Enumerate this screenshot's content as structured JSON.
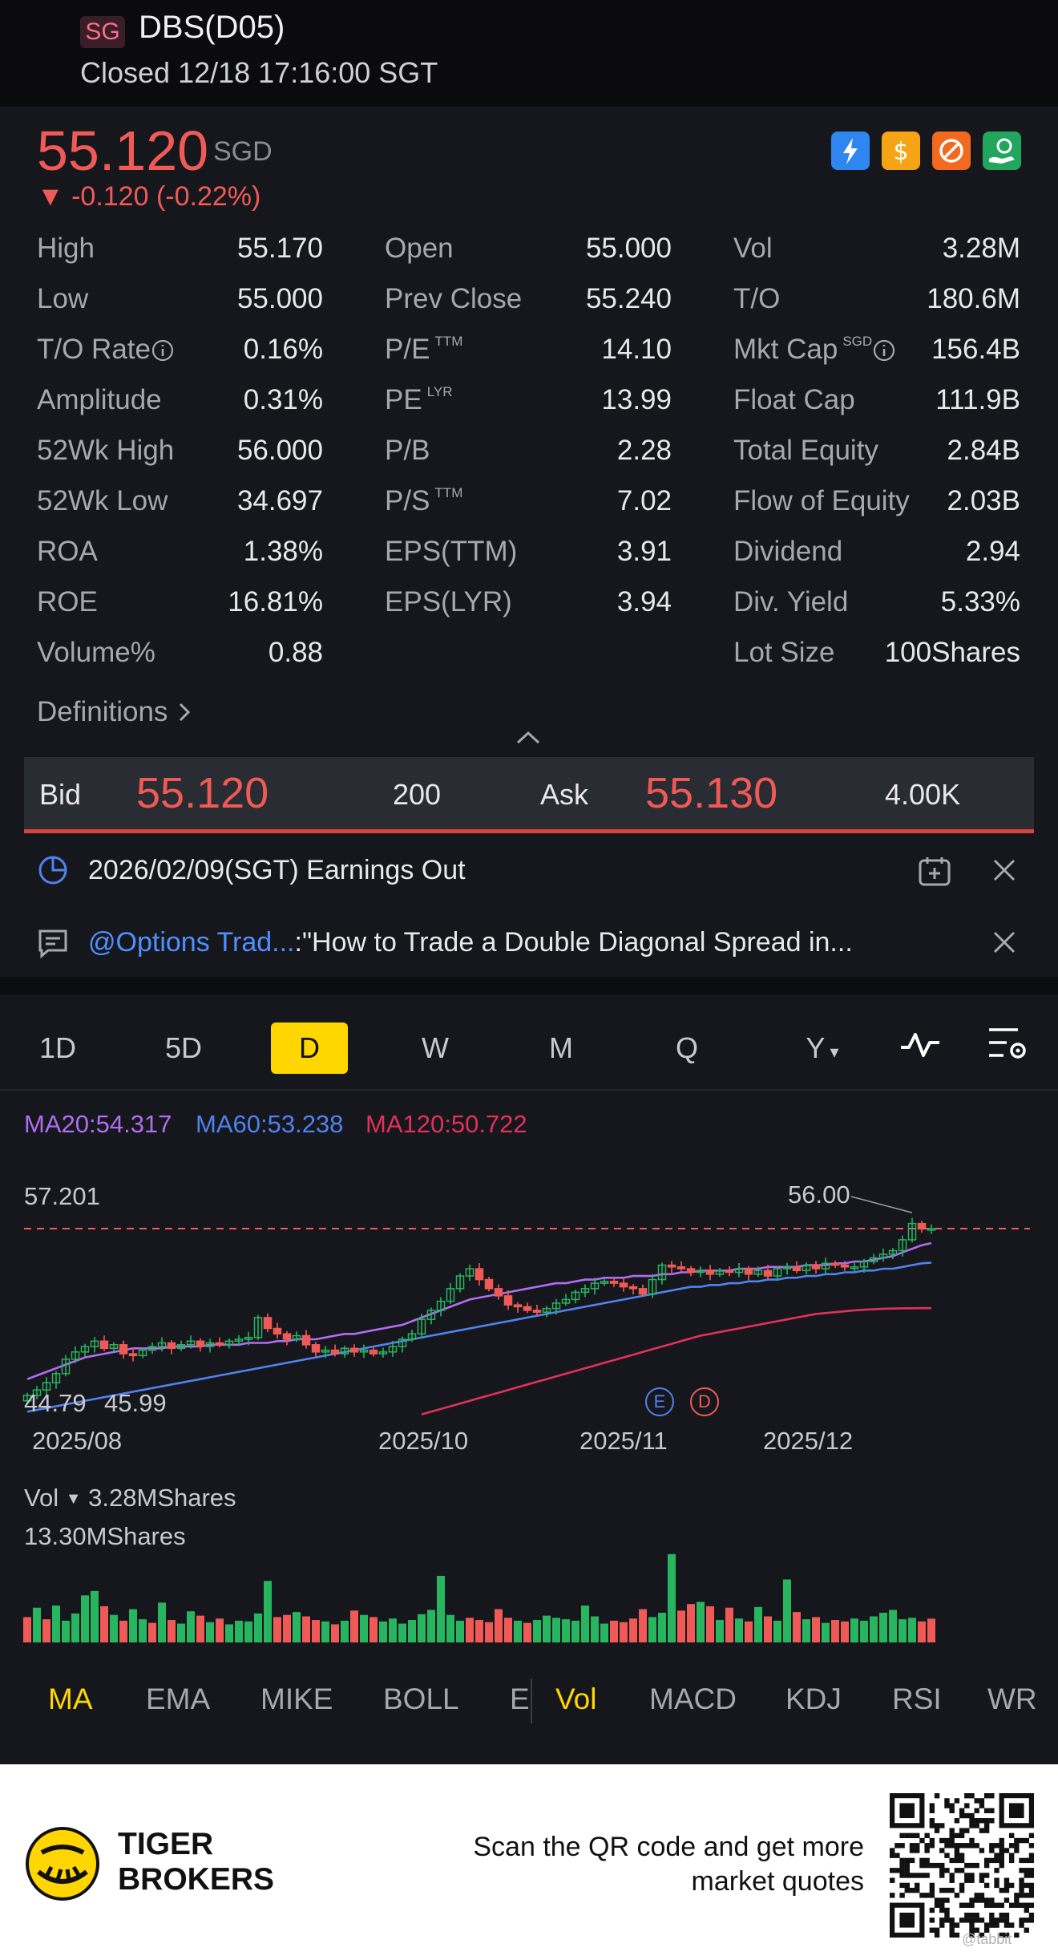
{
  "header": {
    "exchange": "SG",
    "title": "DBS(D05)",
    "status": "Closed 12/18 17:16:00 SGT"
  },
  "quote": {
    "price": "55.120",
    "currency": "SGD",
    "change": "▼ -0.120 (-0.22%)",
    "icons": [
      "lightning-icon",
      "dollar-icon",
      "no-short-icon",
      "money-hand-icon"
    ],
    "stats": [
      [
        {
          "label": "High",
          "value": "55.170"
        },
        {
          "label": "Open",
          "value": "55.000"
        },
        {
          "label": "Vol",
          "value": "3.28M"
        }
      ],
      [
        {
          "label": "Low",
          "value": "55.000"
        },
        {
          "label": "Prev Close",
          "value": "55.240"
        },
        {
          "label": "T/O",
          "value": "180.6M"
        }
      ],
      [
        {
          "label": "T/O Rate",
          "value": "0.16%"
        },
        {
          "label": "P/E",
          "sup": "TTM",
          "value": "14.10"
        },
        {
          "label": "Mkt Cap",
          "sup": "SGD",
          "value": "156.4B"
        }
      ],
      [
        {
          "label": "Amplitude",
          "value": "0.31%"
        },
        {
          "label": "PE",
          "sup": "LYR",
          "value": "13.99"
        },
        {
          "label": "Float Cap",
          "value": "111.9B"
        }
      ],
      [
        {
          "label": "52Wk High",
          "value": "56.000"
        },
        {
          "label": "P/B",
          "value": "2.28"
        },
        {
          "label": "Total Equity",
          "value": "2.84B"
        }
      ],
      [
        {
          "label": "52Wk Low",
          "value": "34.697"
        },
        {
          "label": "P/S",
          "sup": "TTM",
          "value": "7.02"
        },
        {
          "label": "Flow of Equity",
          "value": "2.03B"
        }
      ],
      [
        {
          "label": "ROA",
          "value": "1.38%"
        },
        {
          "label": "EPS(TTM)",
          "value": "3.91"
        },
        {
          "label": "Dividend",
          "value": "2.94"
        }
      ],
      [
        {
          "label": "ROE",
          "value": "16.81%"
        },
        {
          "label": "EPS(LYR)",
          "value": "3.94"
        },
        {
          "label": "Div. Yield",
          "value": "5.33%"
        }
      ],
      [
        {
          "label": "Volume%",
          "value": "0.88"
        },
        {
          "label": "",
          "value": ""
        },
        {
          "label": "Lot Size",
          "value": "100Shares"
        }
      ]
    ],
    "definitions": "Definitions"
  },
  "bidask": {
    "bid_label": "Bid",
    "bid_price": "55.120",
    "bid_size": "200",
    "ask_label": "Ask",
    "ask_price": "55.130",
    "ask_size": "4.00K"
  },
  "notices": {
    "earnings": "2026/02/09(SGT) Earnings Out",
    "post_handle": "@Options Trad...",
    "post_text": ":\"How to Trade a Double Diagonal Spread in..."
  },
  "periods": [
    "1D",
    "5D",
    "D",
    "W",
    "M",
    "Q",
    "Y"
  ],
  "active_period": "D",
  "ma_legend": {
    "ma20": "MA20:54.317",
    "ma60": "MA60:53.238",
    "ma120": "MA120:50.722"
  },
  "colors": {
    "up": "#27b560",
    "down": "#f05a56",
    "ma20": "#b06cf2",
    "ma60": "#4f82ee",
    "ma120": "#e2305b",
    "accent": "#ffd600"
  },
  "chart_data": {
    "type": "candlestick",
    "price_high_label": "57.201",
    "price_low_label": "44.79",
    "marked_high": "56.00",
    "marked_low": "45.99",
    "event_markers": [
      "E",
      "D"
    ],
    "x_ticks": [
      "2025/08",
      "2025/10",
      "2025/11",
      "2025/12"
    ],
    "ylim": [
      44.79,
      57.201
    ],
    "closes": [
      45.9,
      46.2,
      46.6,
      47.1,
      47.9,
      48.3,
      48.6,
      48.9,
      48.5,
      48.7,
      48.2,
      48.1,
      48.4,
      48.6,
      48.8,
      48.5,
      48.7,
      48.9,
      48.6,
      48.8,
      48.7,
      48.9,
      49.0,
      49.1,
      50.2,
      49.6,
      49.3,
      49.0,
      49.2,
      48.7,
      48.3,
      48.4,
      48.2,
      48.5,
      48.3,
      48.4,
      48.2,
      48.3,
      48.6,
      49.0,
      49.3,
      50.1,
      50.6,
      51.1,
      51.8,
      52.5,
      52.9,
      52.3,
      51.8,
      51.4,
      50.9,
      50.8,
      50.6,
      50.5,
      50.7,
      51.0,
      51.2,
      51.6,
      51.8,
      52.1,
      52.2,
      52.1,
      51.9,
      51.8,
      51.5,
      52.3,
      53.1,
      53.0,
      52.9,
      52.7,
      52.8,
      52.6,
      52.8,
      52.7,
      52.9,
      52.6,
      52.8,
      52.5,
      52.9,
      53.0,
      52.8,
      53.1,
      52.9,
      53.2,
      53.1,
      53.0,
      53.0,
      53.3,
      53.5,
      53.7,
      53.9,
      54.5,
      55.4,
      55.1,
      55.12
    ],
    "ma20": [
      46.8,
      47.0,
      47.2,
      47.4,
      47.6,
      47.8,
      48.0,
      48.1,
      48.2,
      48.3,
      48.4,
      48.5,
      48.5,
      48.5,
      48.5,
      48.6,
      48.6,
      48.6,
      48.6,
      48.7,
      48.7,
      48.7,
      48.7,
      48.8,
      48.8,
      48.8,
      48.9,
      48.9,
      49.0,
      49.0,
      49.0,
      49.1,
      49.2,
      49.3,
      49.3,
      49.4,
      49.5,
      49.6,
      49.7,
      49.8,
      50.0,
      50.2,
      50.4,
      50.6,
      50.8,
      51.0,
      51.2,
      51.3,
      51.4,
      51.5,
      51.6,
      51.7,
      51.8,
      51.9,
      52.0,
      52.1,
      52.1,
      52.2,
      52.3,
      52.3,
      52.4,
      52.4,
      52.4,
      52.5,
      52.5,
      52.5,
      52.6,
      52.6,
      52.7,
      52.7,
      52.8,
      52.8,
      52.8,
      52.8,
      52.9,
      52.9,
      52.9,
      53.0,
      53.0,
      53.0,
      53.0,
      53.1,
      53.1,
      53.1,
      53.2,
      53.2,
      53.3,
      53.3,
      53.4,
      53.5,
      53.6,
      53.8,
      54.0,
      54.2,
      54.317
    ],
    "ma60": [
      45.0,
      45.1,
      45.2,
      45.3,
      45.4,
      45.5,
      45.6,
      45.7,
      45.8,
      45.9,
      46.0,
      46.1,
      46.2,
      46.3,
      46.4,
      46.5,
      46.6,
      46.7,
      46.8,
      46.9,
      47.0,
      47.1,
      47.2,
      47.3,
      47.4,
      47.5,
      47.6,
      47.7,
      47.8,
      47.9,
      48.0,
      48.1,
      48.2,
      48.3,
      48.4,
      48.5,
      48.6,
      48.7,
      48.8,
      48.9,
      49.0,
      49.1,
      49.2,
      49.3,
      49.4,
      49.5,
      49.6,
      49.7,
      49.8,
      49.9,
      50.0,
      50.1,
      50.2,
      50.3,
      50.4,
      50.5,
      50.6,
      50.7,
      50.8,
      50.9,
      51.0,
      51.1,
      51.2,
      51.3,
      51.4,
      51.5,
      51.6,
      51.7,
      51.8,
      51.9,
      51.9,
      52.0,
      52.0,
      52.1,
      52.1,
      52.2,
      52.2,
      52.3,
      52.3,
      52.4,
      52.4,
      52.5,
      52.5,
      52.6,
      52.6,
      52.7,
      52.7,
      52.8,
      52.8,
      52.9,
      52.9,
      53.0,
      53.1,
      53.2,
      53.238
    ],
    "ma120": [
      null,
      null,
      null,
      null,
      null,
      null,
      null,
      null,
      null,
      null,
      null,
      null,
      null,
      null,
      null,
      null,
      null,
      null,
      null,
      null,
      null,
      null,
      null,
      null,
      null,
      null,
      null,
      null,
      null,
      null,
      null,
      null,
      null,
      null,
      null,
      null,
      null,
      null,
      null,
      null,
      null,
      44.85,
      45.0,
      45.15,
      45.3,
      45.45,
      45.6,
      45.75,
      45.9,
      46.05,
      46.2,
      46.35,
      46.5,
      46.65,
      46.8,
      46.95,
      47.1,
      47.25,
      47.4,
      47.55,
      47.7,
      47.85,
      48.0,
      48.15,
      48.3,
      48.45,
      48.6,
      48.75,
      48.9,
      49.05,
      49.2,
      49.3,
      49.4,
      49.5,
      49.6,
      49.7,
      49.8,
      49.9,
      50.0,
      50.1,
      50.2,
      50.3,
      50.4,
      50.45,
      50.5,
      50.55,
      50.6,
      50.63,
      50.66,
      50.69,
      50.7,
      50.71,
      50.715,
      50.72,
      50.722
    ]
  },
  "volume": {
    "label": "Vol",
    "current": "3.28MShares",
    "max_label": "13.30MShares",
    "bars": [
      3.5,
      4.8,
      3.2,
      5.1,
      3.0,
      4.0,
      6.5,
      7.1,
      5.0,
      3.8,
      3.0,
      4.6,
      3.2,
      2.7,
      5.5,
      3.1,
      2.6,
      4.3,
      3.7,
      2.8,
      3.3,
      2.5,
      3.0,
      2.9,
      4.0,
      8.5,
      3.5,
      3.8,
      4.2,
      3.6,
      3.1,
      2.9,
      2.5,
      3.0,
      4.4,
      3.8,
      3.5,
      2.9,
      3.3,
      2.6,
      3.1,
      3.9,
      4.5,
      9.2,
      3.8,
      3.0,
      3.4,
      3.1,
      2.8,
      4.6,
      3.4,
      3.0,
      2.7,
      3.1,
      3.7,
      3.4,
      3.2,
      3.0,
      5.1,
      3.6,
      2.6,
      3.0,
      2.8,
      3.3,
      4.6,
      3.5,
      4.1,
      12.2,
      4.4,
      5.3,
      5.6,
      5.0,
      3.1,
      4.8,
      3.3,
      2.9,
      4.9,
      3.6,
      3.0,
      8.7,
      4.2,
      3.2,
      3.5,
      2.7,
      3.1,
      2.9,
      3.3,
      3.0,
      3.6,
      4.1,
      4.5,
      3.2,
      3.4,
      2.9,
      3.28
    ],
    "up": [
      0,
      1,
      0,
      1,
      1,
      1,
      1,
      1,
      0,
      1,
      0,
      1,
      1,
      0,
      1,
      0,
      1,
      1,
      0,
      1,
      0,
      1,
      1,
      1,
      1,
      1,
      0,
      0,
      1,
      0,
      0,
      1,
      0,
      1,
      0,
      1,
      0,
      1,
      1,
      1,
      1,
      1,
      1,
      1,
      1,
      1,
      0,
      0,
      0,
      0,
      0,
      1,
      0,
      1,
      1,
      1,
      1,
      1,
      1,
      1,
      1,
      0,
      0,
      0,
      0,
      1,
      1,
      1,
      0,
      0,
      1,
      0,
      1,
      0,
      1,
      0,
      1,
      0,
      1,
      1,
      0,
      1,
      0,
      1,
      0,
      0,
      1,
      1,
      1,
      1,
      1,
      1,
      1,
      0,
      0
    ]
  },
  "indicators": [
    "MA",
    "EMA",
    "MIKE",
    "BOLL",
    "E",
    "Vol",
    "MACD",
    "KDJ",
    "RSI",
    "WR"
  ],
  "active_indicators": [
    "MA",
    "Vol"
  ],
  "footer": {
    "brand_line1": "TIGER",
    "brand_line2": "BROKERS",
    "cta_line1": "Scan the QR code and get more",
    "cta_line2": "market quotes",
    "qr_caption": "@tabbit"
  }
}
